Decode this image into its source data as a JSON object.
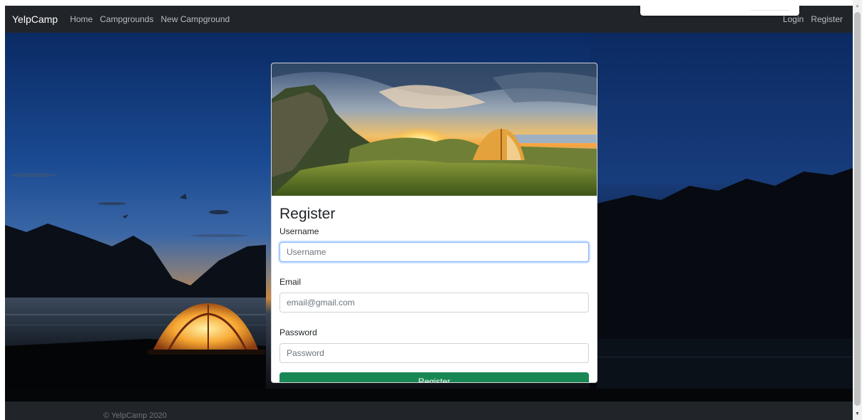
{
  "navbar": {
    "brand": "YelpCamp",
    "links": [
      {
        "label": "Home"
      },
      {
        "label": "Campgrounds"
      },
      {
        "label": "New Campground"
      }
    ],
    "right_links": [
      {
        "label": "Login"
      },
      {
        "label": "Register"
      }
    ]
  },
  "register_card": {
    "title": "Register",
    "fields": {
      "username": {
        "label": "Username",
        "placeholder": "Username",
        "value": ""
      },
      "email": {
        "label": "Email",
        "placeholder": "email@gmail.com",
        "value": ""
      },
      "password": {
        "label": "Password",
        "placeholder": "Password",
        "value": ""
      }
    },
    "submit_label": "Register"
  },
  "footer": {
    "text": "© YelpCamp 2020"
  },
  "colors": {
    "navbar_bg": "#212529",
    "submit_bg": "#198754",
    "focus_ring": "#86b7fe"
  },
  "icons": {
    "scroll_up": "scroll-up-arrow-icon",
    "scroll_down": "scroll-down-arrow-icon"
  }
}
